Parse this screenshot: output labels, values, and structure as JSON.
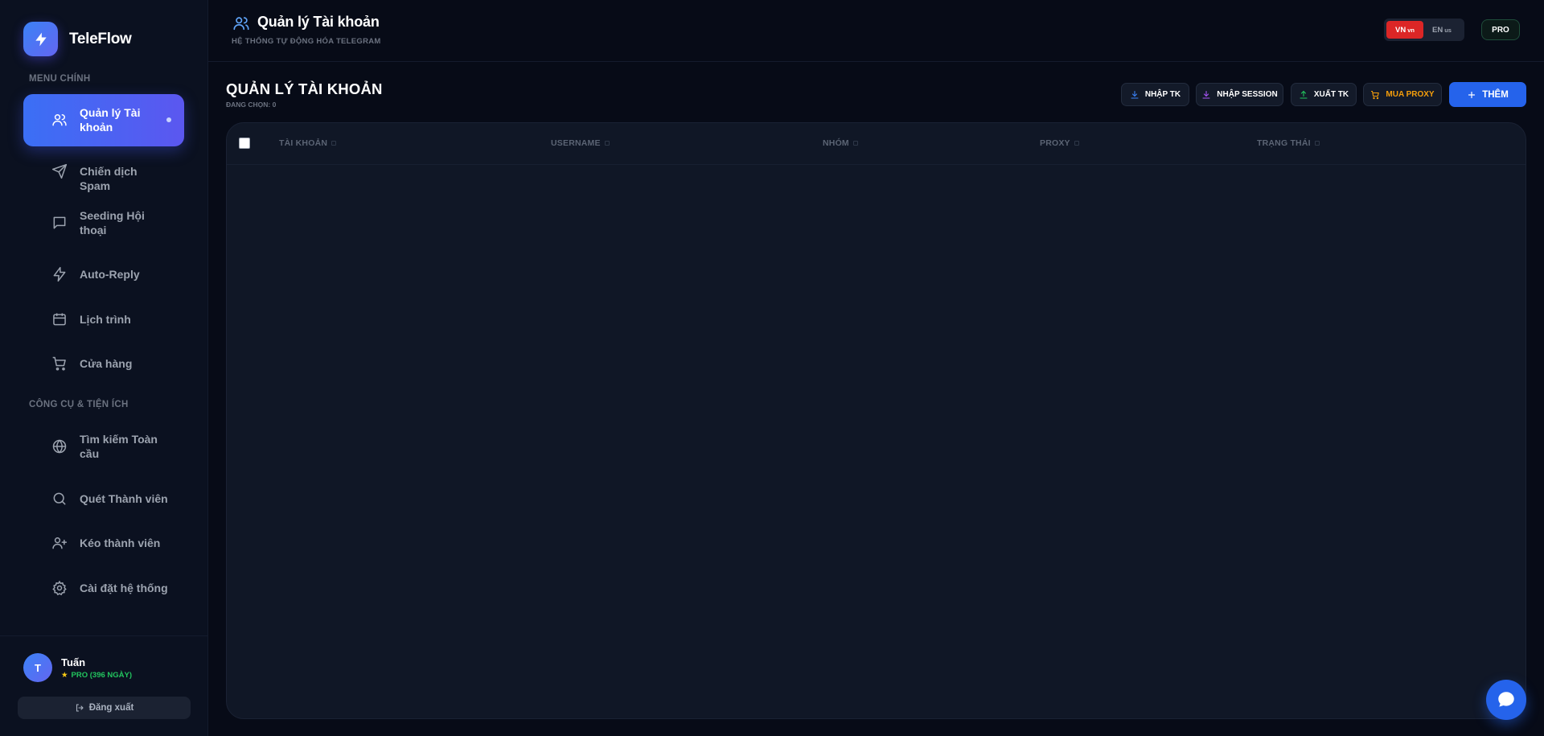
{
  "brand": {
    "name": "TeleFlow"
  },
  "sidebar": {
    "section_main": "MENU CHÍNH",
    "section_tools": "CÔNG CỤ & TIỆN ÍCH",
    "items": [
      {
        "label": "Quản lý Tài khoản",
        "icon": "users-icon"
      },
      {
        "label": "Chiến dịch Spam",
        "icon": "send-icon"
      },
      {
        "label": "Seeding Hội thoại",
        "icon": "message-icon"
      },
      {
        "label": "Auto-Reply",
        "icon": "bolt-icon"
      },
      {
        "label": "Lịch trình",
        "icon": "calendar-icon"
      },
      {
        "label": "Cửa hàng",
        "icon": "cart-icon"
      }
    ],
    "tools": [
      {
        "label": "Tìm kiếm Toàn cầu",
        "icon": "globe-icon"
      },
      {
        "label": "Quét Thành viên",
        "icon": "search-icon"
      },
      {
        "label": "Kéo thành viên",
        "icon": "user-plus-icon"
      },
      {
        "label": "Cài đặt hệ thống",
        "icon": "gear-icon"
      }
    ],
    "user": {
      "initial": "T",
      "name": "Tuấn",
      "plan": "PRO (396 NGÀY)"
    },
    "logout": "Đăng xuất"
  },
  "header": {
    "title": "Quản lý Tài khoản",
    "subtitle": "HỆ THỐNG TỰ ĐỘNG HÓA TELEGRAM",
    "lang": {
      "vn": "VN",
      "vn_small": "vn",
      "en": "EN",
      "en_small": "us"
    },
    "pro_badge": "PRO"
  },
  "page": {
    "title": "QUẢN LÝ TÀI KHOẢN",
    "selected": "ĐANG CHỌN: 0"
  },
  "toolbar": {
    "import_account": "NHẬP TK",
    "import_session": "NHẬP SESSION",
    "export_account": "XUẤT TK",
    "buy_proxy": "MUA PROXY",
    "add": "THÊM"
  },
  "table": {
    "columns": [
      "TÀI KHOẢN",
      "USERNAME",
      "NHÓM",
      "PROXY",
      "TRẠNG THÁI"
    ]
  },
  "colors": {
    "accent": "#2563eb",
    "brand_gradient_end": "#6366f1",
    "danger": "#dc2626",
    "warning": "#f59e0b",
    "success": "#22c55e"
  }
}
